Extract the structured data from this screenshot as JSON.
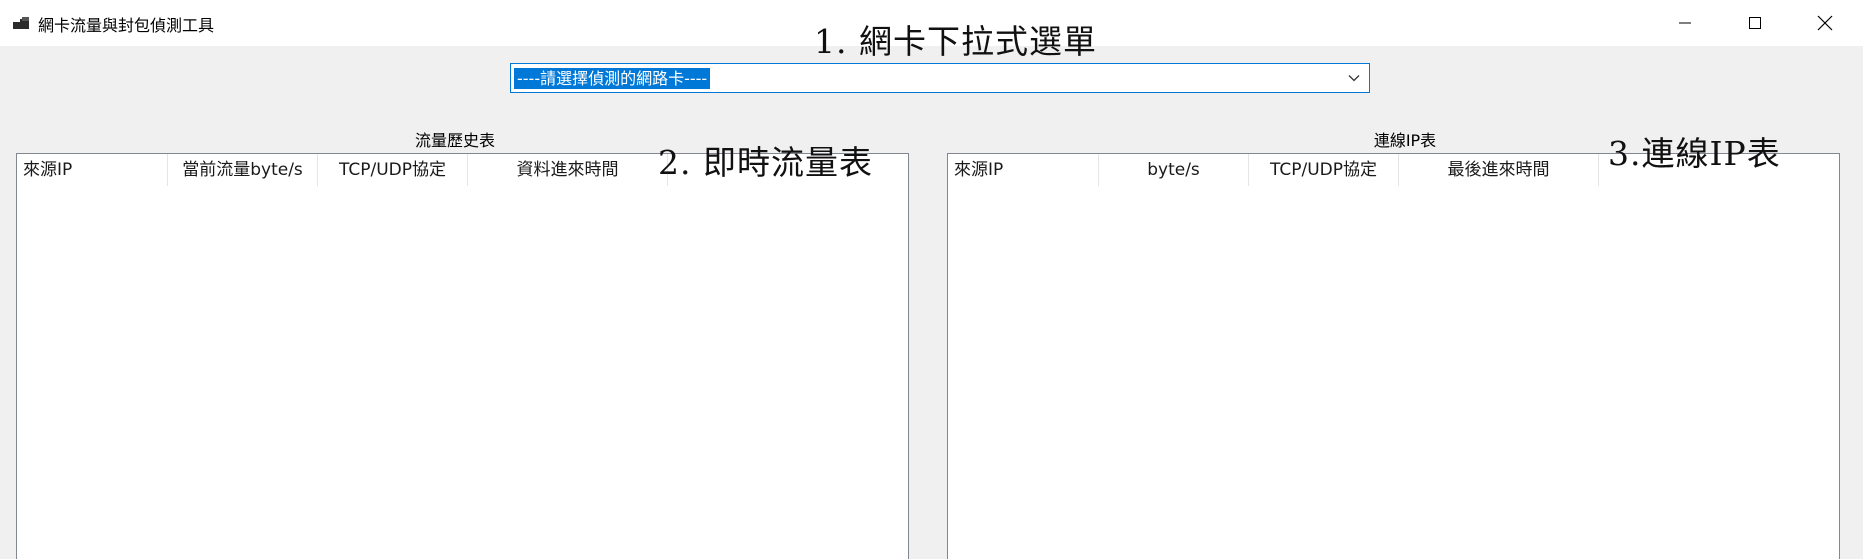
{
  "window": {
    "title": "網卡流量與封包偵測工具",
    "icon": "app-window-icon",
    "controls": {
      "minimize_icon": "minimize-icon",
      "maximize_icon": "maximize-icon",
      "close_icon": "close-icon"
    }
  },
  "annotations": {
    "dropdown": "1.  網卡下拉式選單",
    "realtime_table": "2.  即時流量表",
    "connection_table": "3.連線IP表"
  },
  "nic_selector": {
    "selected_value": "----請選擇偵測的網路卡----",
    "icon": "chevron-down-icon"
  },
  "traffic_history": {
    "title": "流量歷史表",
    "columns": [
      "來源IP",
      "當前流量byte/s",
      "TCP/UDP協定",
      "資料進來時間"
    ],
    "rows": []
  },
  "connection_ips": {
    "title": "連線IP表",
    "columns": [
      "來源IP",
      "byte/s",
      "TCP/UDP協定",
      "最後進來時間"
    ],
    "rows": []
  },
  "colors": {
    "selection": "#0078d7",
    "background": "#f0f0f0",
    "titlebar": "#ffffff",
    "list_border": "#828790"
  }
}
